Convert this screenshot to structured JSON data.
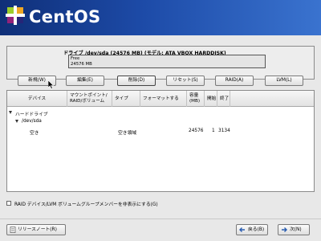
{
  "header": {
    "logo_text": "CentOS",
    "background_color": "#1d4ba8"
  },
  "drive": {
    "title": "ドライブ /dev/sda (24576 MB) (モデル: ATA VBOX HARDDISK)",
    "bar_line1": "Free",
    "bar_line2": "24576 MB"
  },
  "buttons": {
    "new": "新規(W)",
    "edit": "編集(E)",
    "delete": "削除(D)",
    "reset": "リセット(S)",
    "raid": "RAID(A)",
    "lvm": "LVM(L)"
  },
  "table": {
    "columns": [
      "デバイス",
      "マウントポイント/\nRAID/ボリューム",
      "タイプ",
      "フォーマットする",
      "容量\n(MB)",
      "開始",
      "終了"
    ],
    "rows": [
      {
        "device": "ハードドライブ",
        "mount": "",
        "type": "",
        "format": "",
        "size": "",
        "start": "",
        "end": ""
      },
      {
        "device": "/dev/sda",
        "mount": "",
        "type": "",
        "format": "",
        "size": "",
        "start": "",
        "end": ""
      },
      {
        "device": "空き",
        "mount": "",
        "type": "空き領域",
        "format": "",
        "size": "24576",
        "start": "1",
        "end": "3134"
      }
    ]
  },
  "checkbox": {
    "label": "RAID デバイス/LVM ボリュームグループメンバーを非表示にする(G)",
    "checked": false
  },
  "footer": {
    "release_notes": "リリースノート(R)",
    "back": "戻る(B)",
    "next": "次(N)"
  }
}
